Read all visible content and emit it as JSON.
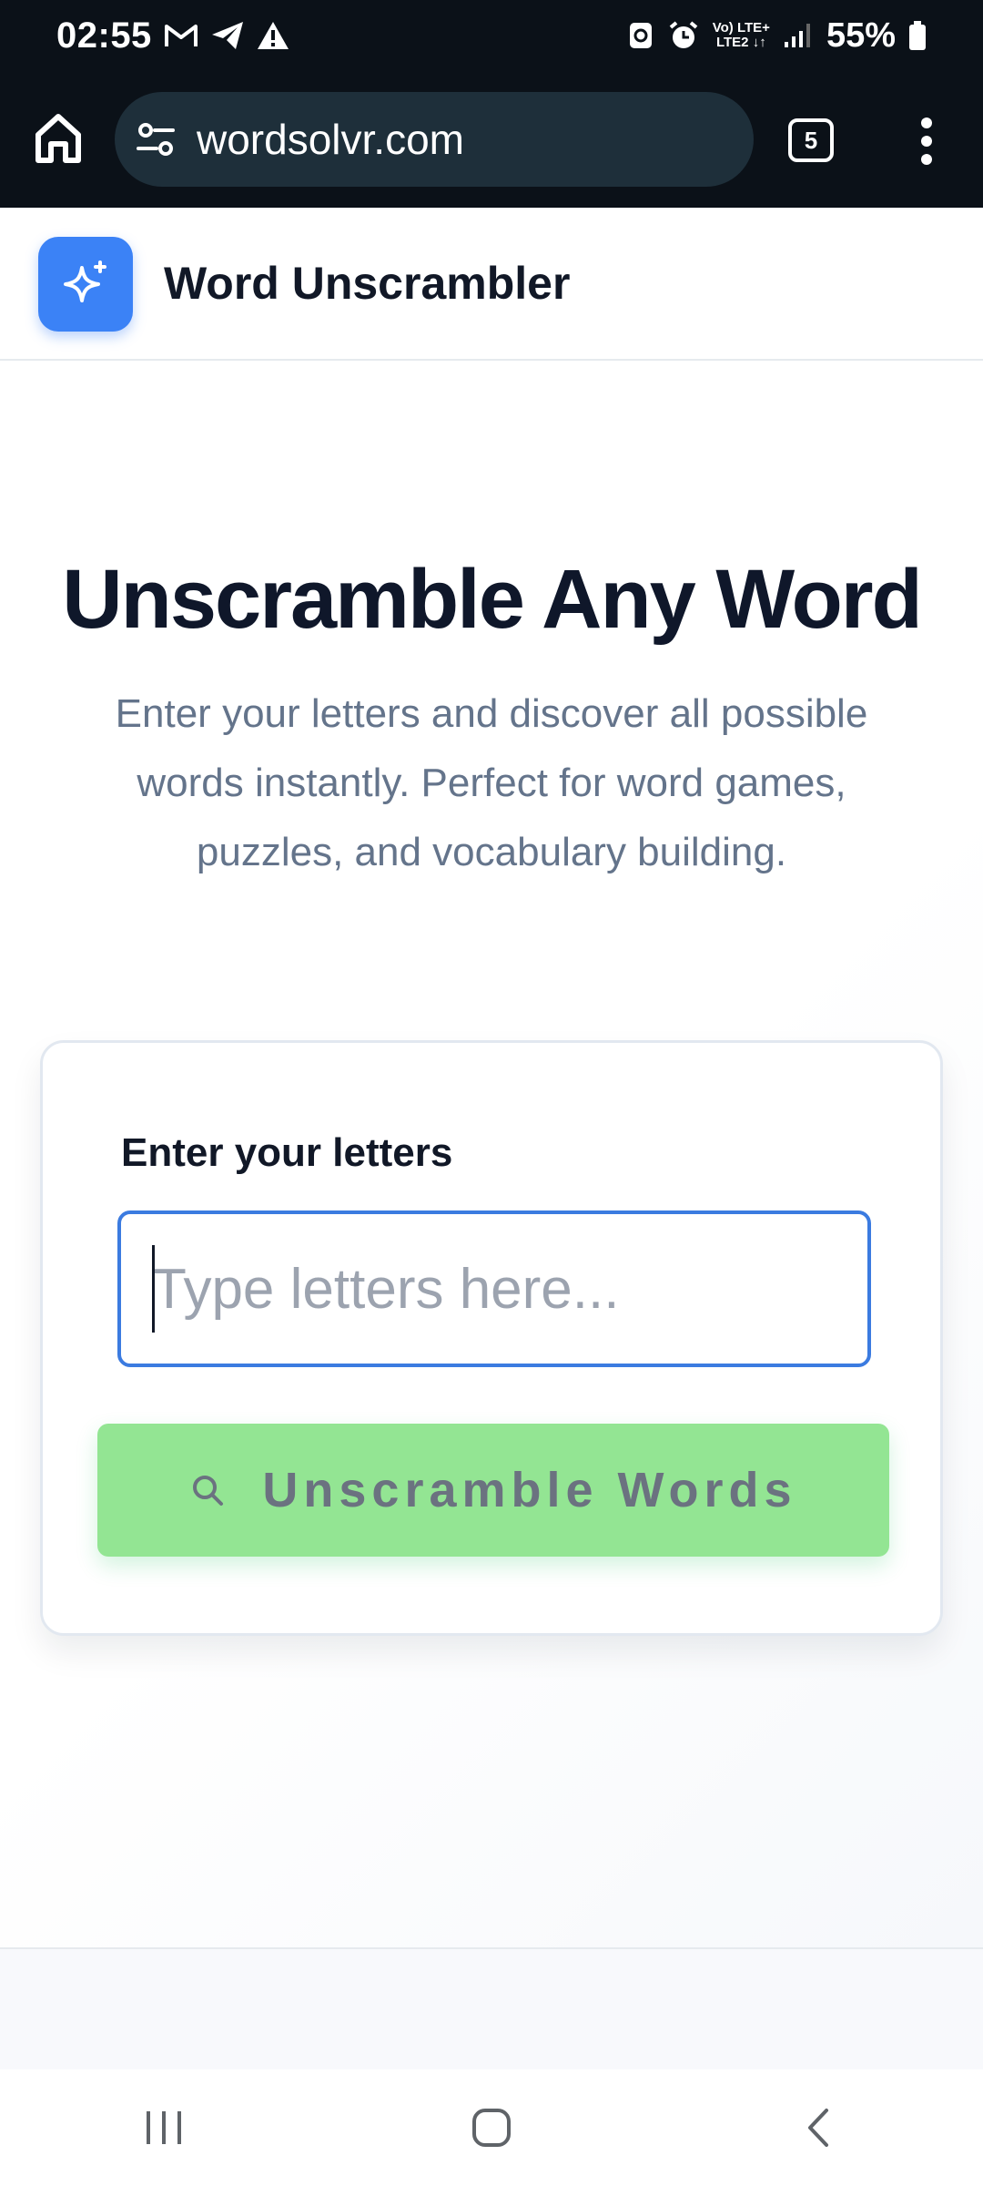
{
  "status_bar": {
    "time": "02:55",
    "net_top": "Vo) LTE+",
    "net_bottom": "LTE2 ↓↑",
    "battery": "55%",
    "icons": [
      "gmail-icon",
      "telegram-icon",
      "warning-icon",
      "recycle-icon",
      "alarm-icon",
      "signal-icon",
      "battery-icon"
    ]
  },
  "browser": {
    "url": "wordsolvr.com",
    "tab_count": "5"
  },
  "header": {
    "title": "Word Unscrambler",
    "logo_icon": "sparkles-icon",
    "accent": "#3b82f6"
  },
  "hero": {
    "title": "Unscramble Any Word",
    "subtitle_lines": [
      "Enter your letters and discover all possible",
      "words instantly. Perfect for word games,",
      "puzzles, and vocabulary building."
    ]
  },
  "form": {
    "label": "Enter your letters",
    "placeholder": "Type letters here...",
    "value": "",
    "button_label": "Unscramble Words",
    "button_icon": "search-icon",
    "button_color": "#93e593"
  },
  "nav": {
    "buttons": [
      "recents-icon",
      "home-icon",
      "back-icon"
    ]
  }
}
